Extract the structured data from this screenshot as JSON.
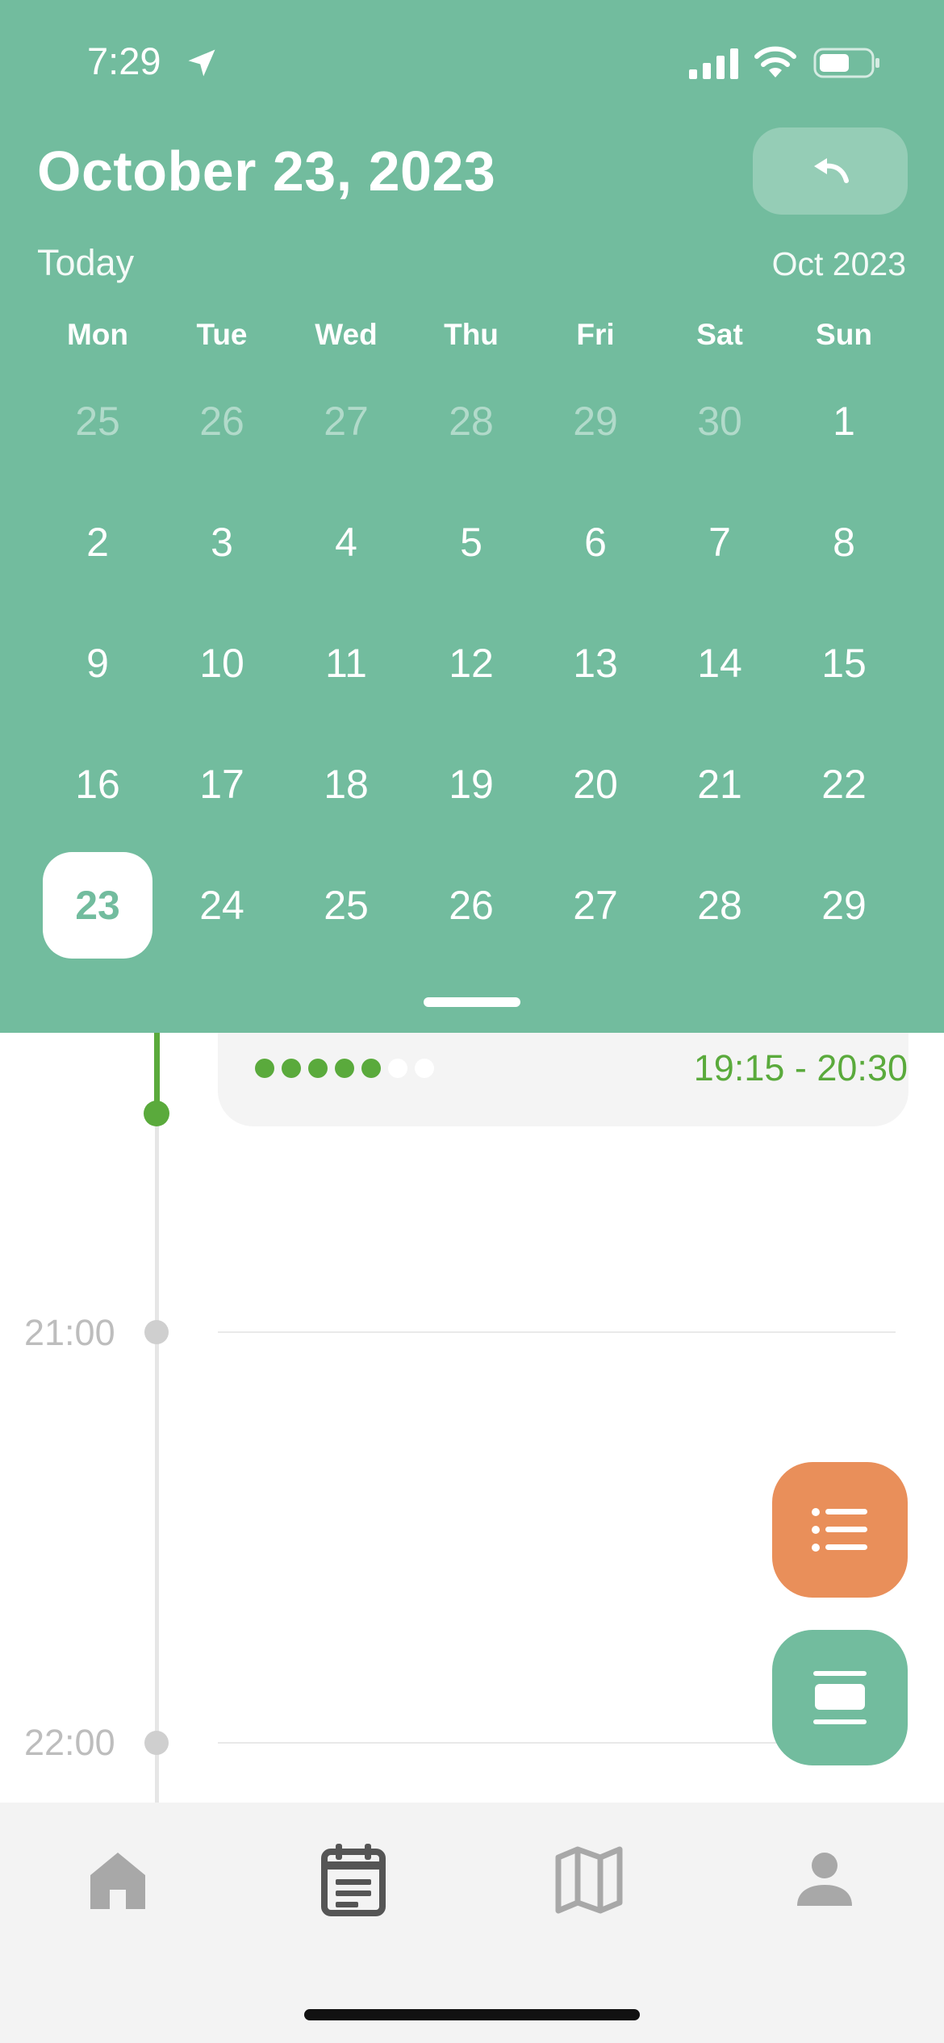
{
  "status_bar": {
    "time": "7:29"
  },
  "header": {
    "title": "October 23, 2023",
    "today_label": "Today",
    "month_label": "Oct 2023"
  },
  "calendar": {
    "weekdays": [
      "Mon",
      "Tue",
      "Wed",
      "Thu",
      "Fri",
      "Sat",
      "Sun"
    ],
    "weeks": [
      [
        "25",
        "26",
        "27",
        "28",
        "29",
        "30",
        "1"
      ],
      [
        "2",
        "3",
        "4",
        "5",
        "6",
        "7",
        "8"
      ],
      [
        "9",
        "10",
        "11",
        "12",
        "13",
        "14",
        "15"
      ],
      [
        "16",
        "17",
        "18",
        "19",
        "20",
        "21",
        "22"
      ],
      [
        "23",
        "24",
        "25",
        "26",
        "27",
        "28",
        "29"
      ]
    ],
    "selected_day": "23"
  },
  "event": {
    "time_range": "19:15 - 20:30",
    "rating_filled": 5,
    "rating_total": 7
  },
  "timeline": {
    "hours": [
      "21:00",
      "22:00"
    ]
  },
  "fabs": {
    "list_icon": "list-icon",
    "view_icon": "card-view-icon"
  },
  "tabbar": {
    "items": [
      "home-icon",
      "schedule-icon",
      "map-icon",
      "profile-icon"
    ],
    "active": "schedule-icon"
  },
  "colors": {
    "header_green": "#72bc9e",
    "accent_green": "#5aaa3c",
    "orange": "#e98f5a",
    "tab_active": "#555555",
    "tab_inactive": "#a8a8a8"
  }
}
